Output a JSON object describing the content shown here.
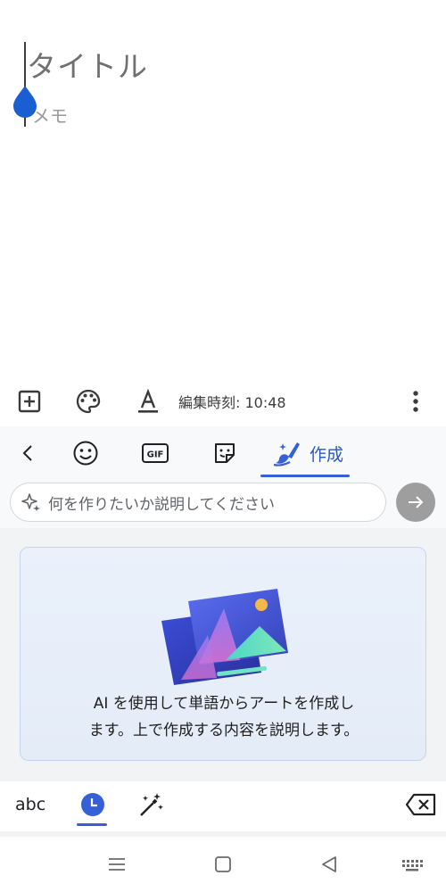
{
  "editor": {
    "title_placeholder": "タイトル",
    "memo_placeholder": "メモ"
  },
  "format_toolbar": {
    "icons": [
      "add-box-icon",
      "palette-icon",
      "text-format-icon",
      "more-vert-icon"
    ],
    "edited_label": "編集時刻: 10:48"
  },
  "keyboard": {
    "tabs": {
      "icons": [
        "back-chevron-icon",
        "emoji-icon",
        "gif-icon",
        "sticker-icon",
        "ai-brush-icon"
      ],
      "gif_text": "GIF",
      "create_label": "作成",
      "active": "作成"
    },
    "prompt": {
      "placeholder": "何を作りたいか説明してください",
      "icon": "sparkle-icon",
      "send_icon": "arrow-right-icon"
    },
    "ai_card": {
      "line1": "AI を使用して単語からアートを作成し",
      "line2": "ます。上で作成する内容を説明します。"
    },
    "bottom_row": {
      "abc_label": "abc",
      "icons": [
        "clock-icon",
        "magic-wand-icon",
        "backspace-icon"
      ]
    }
  },
  "navbar": {
    "icons": [
      "recents-icon",
      "home-icon",
      "back-icon",
      "keyboard-icon"
    ]
  },
  "colors": {
    "accent": "#3560d8",
    "caret_handle": "#1a5fd1",
    "send_button": "#9e9e9e",
    "card_bg": "#e8eff9"
  }
}
